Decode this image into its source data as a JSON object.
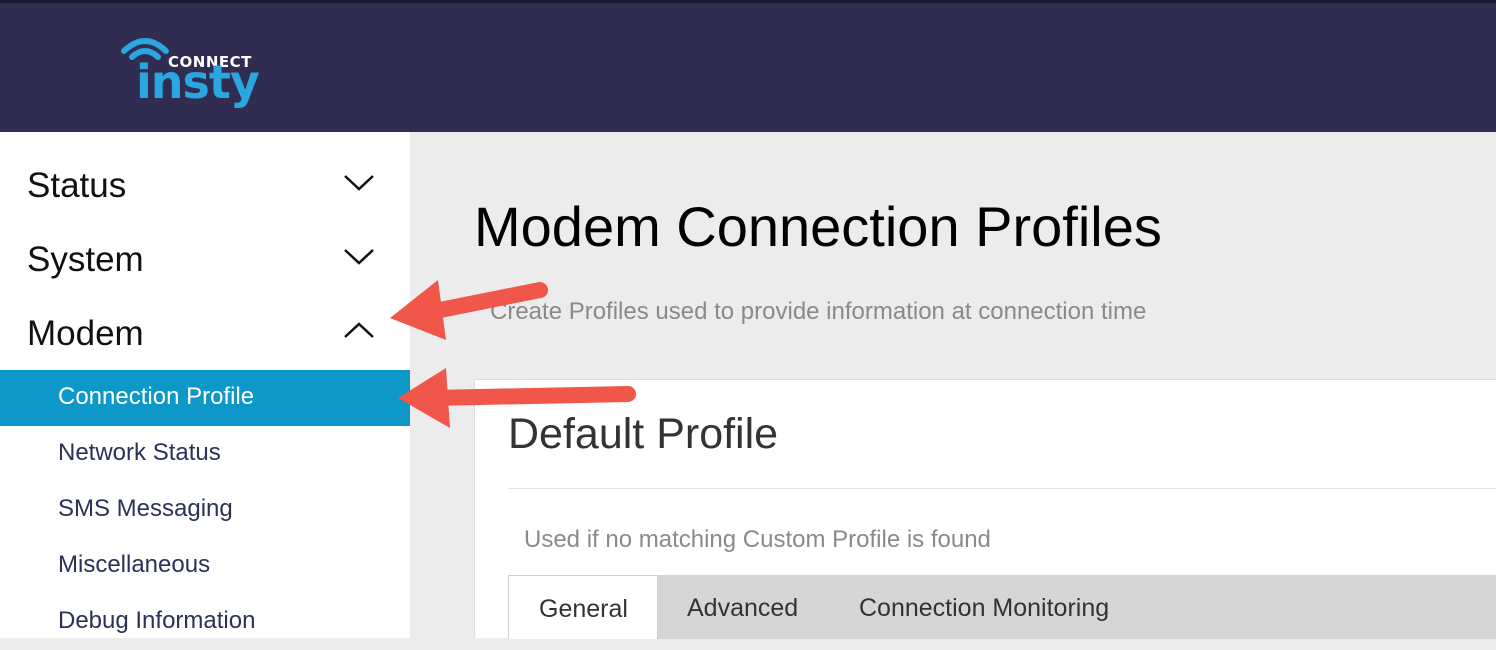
{
  "header": {
    "logo_connect": "CONNECT",
    "logo_brand": "insty",
    "background_color": "#312c51",
    "brand_color": "#2aa7e0"
  },
  "sidebar": {
    "groups": [
      {
        "label": "Status",
        "state": "collapsed",
        "icon": "chevron-down-icon"
      },
      {
        "label": "System",
        "state": "collapsed",
        "icon": "chevron-down-icon"
      },
      {
        "label": "Modem",
        "state": "expanded",
        "icon": "chevron-up-icon"
      }
    ],
    "modem_items": [
      {
        "label": "Connection Profile",
        "active": true
      },
      {
        "label": "Network Status",
        "active": false
      },
      {
        "label": "SMS Messaging",
        "active": false
      },
      {
        "label": "Miscellaneous",
        "active": false
      },
      {
        "label": "Debug Information",
        "active": false
      }
    ],
    "active_color": "#0d98c9"
  },
  "main": {
    "title": "Modem Connection Profiles",
    "subtitle": "Create Profiles used to provide information at connection time",
    "card": {
      "title": "Default Profile",
      "description": "Used if no matching Custom Profile is found",
      "tabs": [
        {
          "label": "General",
          "active": true
        },
        {
          "label": "Advanced",
          "active": false
        },
        {
          "label": "Connection Monitoring",
          "active": false
        }
      ]
    }
  },
  "annotations": {
    "arrow_color": "#f0574a",
    "arrows": [
      {
        "points_to": "sidebar-group-modem"
      },
      {
        "points_to": "sidebar-item-connection-profile"
      }
    ]
  }
}
